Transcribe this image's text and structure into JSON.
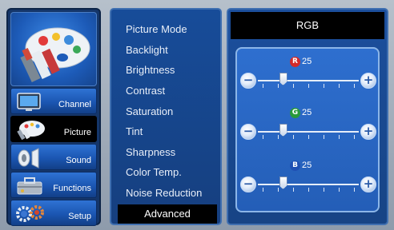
{
  "categories": [
    {
      "label": "Channel",
      "icon": "tv-icon"
    },
    {
      "label": "Picture",
      "icon": "palette-icon"
    },
    {
      "label": "Sound",
      "icon": "speaker-icon"
    },
    {
      "label": "Functions",
      "icon": "toolbox-icon"
    },
    {
      "label": "Setup",
      "icon": "gears-icon"
    }
  ],
  "selected_category": "Picture",
  "menu": {
    "items": [
      "Picture Mode",
      "Backlight",
      "Brightness",
      "Contrast",
      "Saturation",
      "Tint",
      "Sharpness",
      "Color Temp.",
      "Noise Reduction",
      "Advanced"
    ],
    "active_item": "Advanced"
  },
  "right_panel": {
    "mode_value": "RGB",
    "sliders": [
      {
        "channel": "R",
        "badge_color": "#d42a2a",
        "value": "25",
        "level": 0.25
      },
      {
        "channel": "G",
        "badge_color": "#2a9a3a",
        "value": "25",
        "level": 0.25
      },
      {
        "channel": "B",
        "badge_color": "#1f4fb3",
        "value": "25",
        "level": 0.25
      }
    ],
    "minus_symbol": "−",
    "plus_symbol": "+"
  },
  "colors": {
    "panel_blue": "#174c99",
    "active_black": "#000000",
    "slider_box": "#2e6fcf"
  }
}
